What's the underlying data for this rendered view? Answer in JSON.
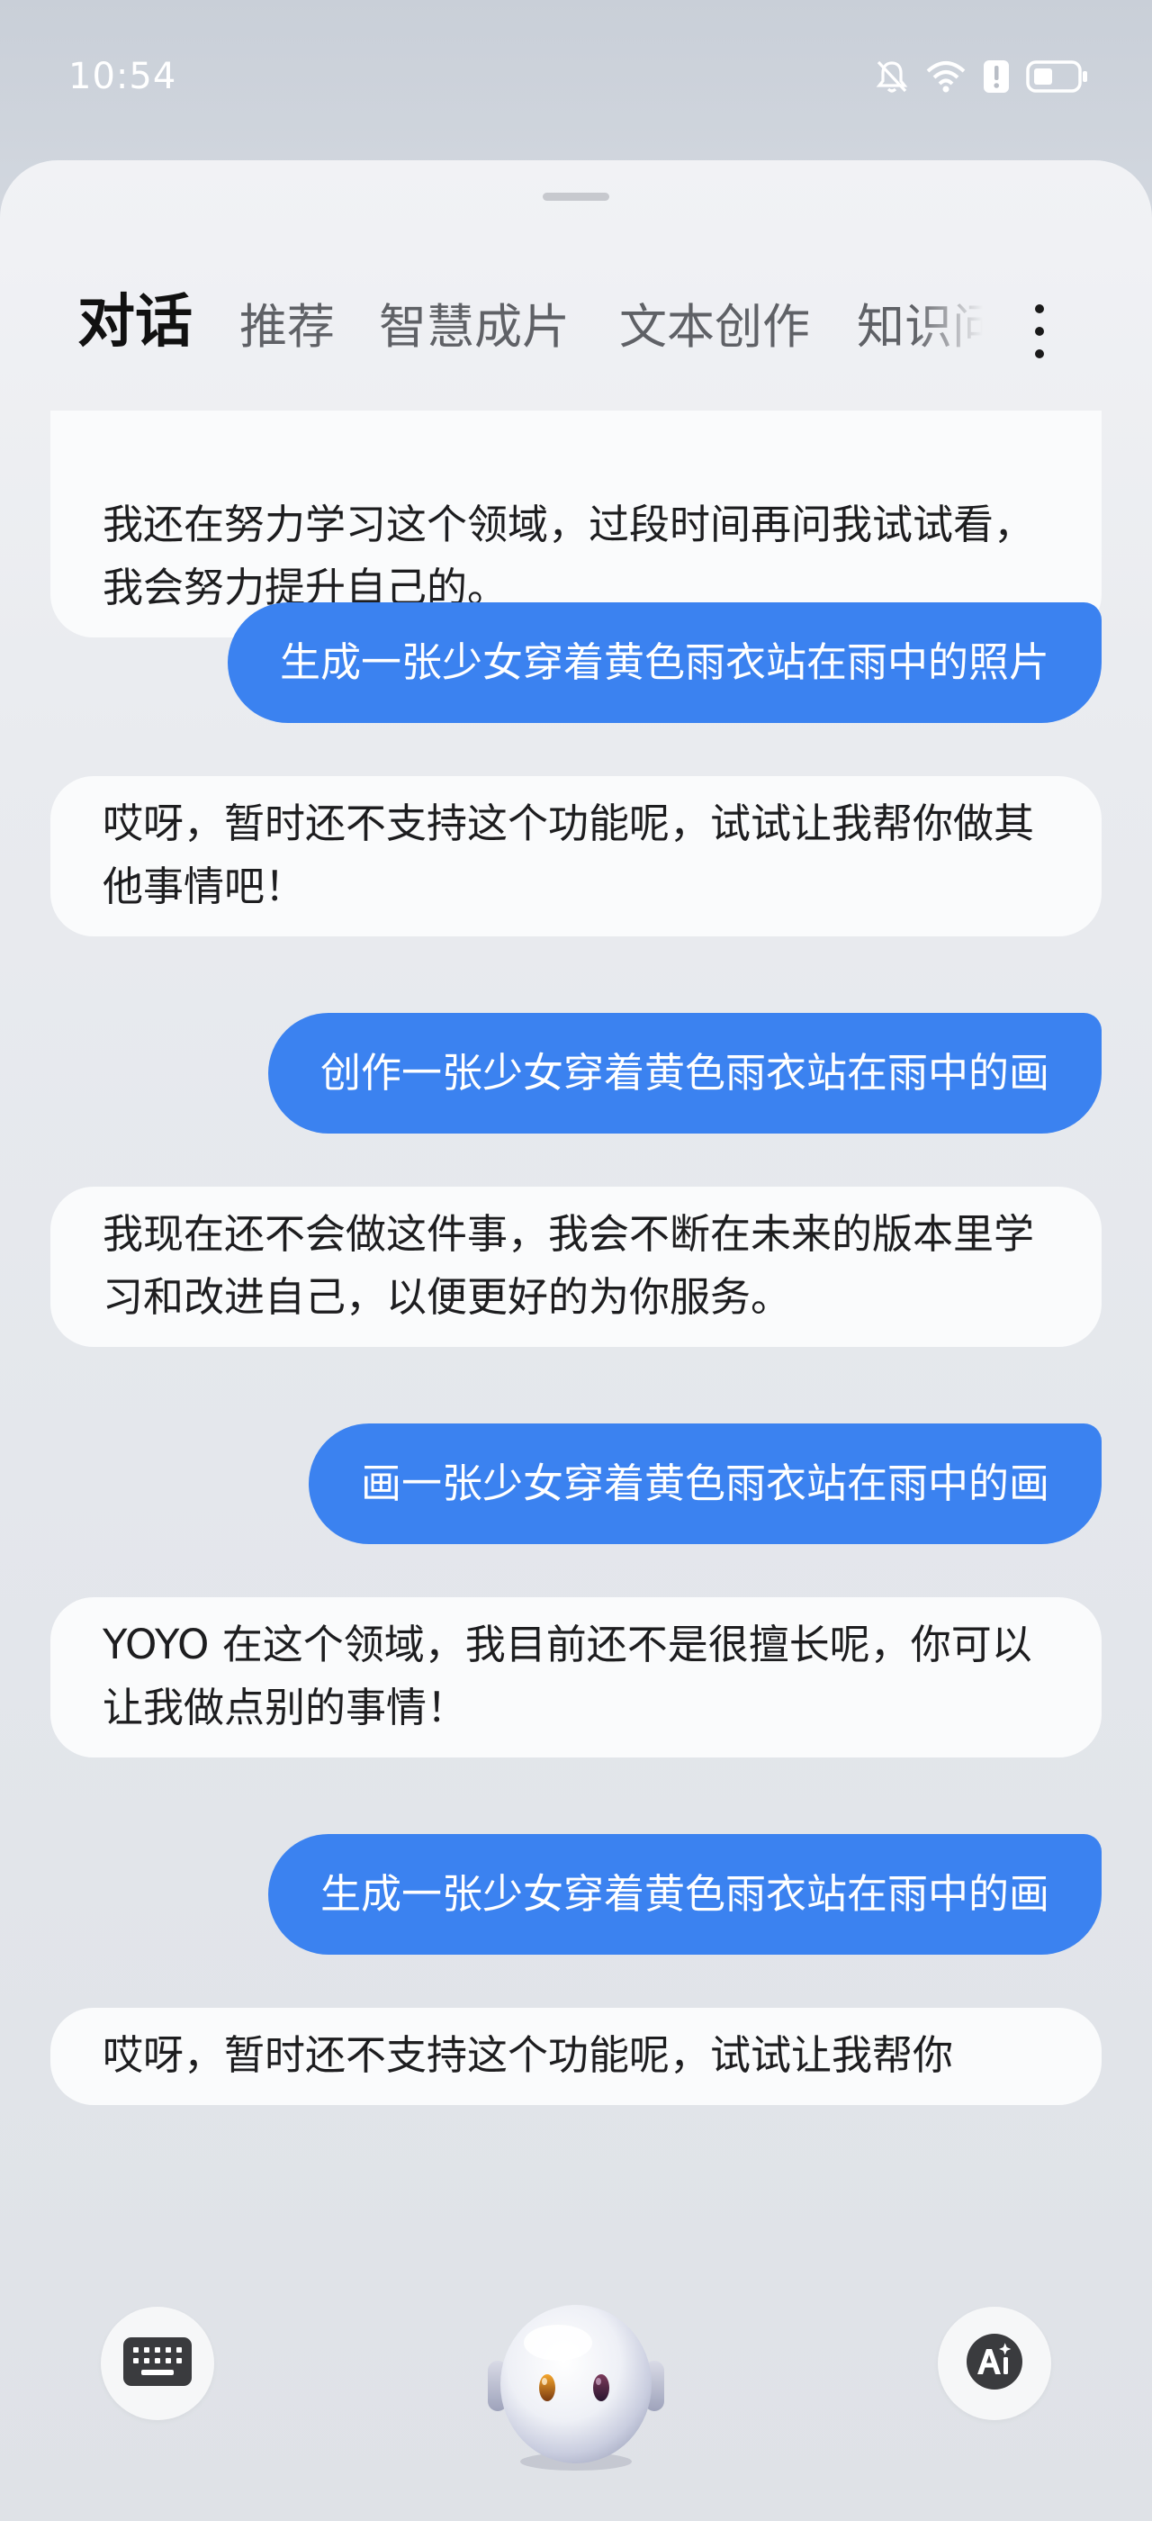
{
  "status_bar": {
    "time": "10:54",
    "icons": [
      "bell-muted-icon",
      "wifi-icon",
      "alert-icon",
      "battery-icon"
    ]
  },
  "tabs": [
    {
      "label": "对话",
      "active": true
    },
    {
      "label": "推荐",
      "active": false
    },
    {
      "label": "智慧成片",
      "active": false
    },
    {
      "label": "文本创作",
      "active": false
    },
    {
      "label": "知识问",
      "active": false
    }
  ],
  "more_icon": "more-vertical-icon",
  "messages": [
    {
      "role": "assistant",
      "text": "我还在努力学习这个领域，过段时间再问我试试看，我会努力提升自己的。"
    },
    {
      "role": "user",
      "text": "生成一张少女穿着黄色雨衣站在雨中的照片"
    },
    {
      "role": "assistant",
      "text": "哎呀，暂时还不支持这个功能呢，试试让我帮你做其他事情吧！"
    },
    {
      "role": "user",
      "text": "创作一张少女穿着黄色雨衣站在雨中的画"
    },
    {
      "role": "assistant",
      "text": "我现在还不会做这件事，我会不断在未来的版本里学习和改进自己，以便更好的为你服务。"
    },
    {
      "role": "user",
      "text": "画一张少女穿着黄色雨衣站在雨中的画"
    },
    {
      "role": "assistant",
      "text": "YOYO 在这个领域，我目前还不是很擅长呢，你可以让我做点别的事情！"
    },
    {
      "role": "user",
      "text": "生成一张少女穿着黄色雨衣站在雨中的画"
    },
    {
      "role": "assistant",
      "text": "哎呀，暂时还不支持这个功能呢，试试让我帮你"
    }
  ],
  "bottom_bar": {
    "keyboard_icon": "keyboard-icon",
    "assistant_icon": "yoyo-avatar-icon",
    "ai_icon": "ai-create-icon"
  },
  "colors": {
    "user_bubble": "#3b82f0",
    "bot_bubble": "#fafbfc",
    "active_tab": "#111111",
    "inactive_tab": "#5f6166"
  }
}
